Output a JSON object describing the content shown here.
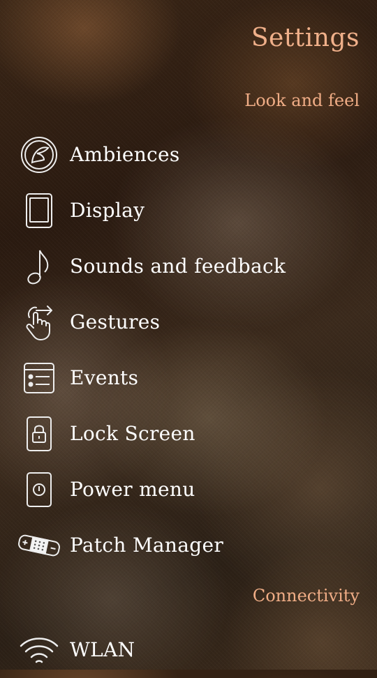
{
  "header": {
    "title": "Settings"
  },
  "sections": [
    {
      "title": "Look and feel",
      "items": [
        {
          "label": "Ambiences",
          "icon": "ambience-icon"
        },
        {
          "label": "Display",
          "icon": "display-icon"
        },
        {
          "label": "Sounds and feedback",
          "icon": "music-note-icon"
        },
        {
          "label": "Gestures",
          "icon": "gesture-hand-icon"
        },
        {
          "label": "Events",
          "icon": "events-icon"
        },
        {
          "label": "Lock Screen",
          "icon": "lock-icon"
        },
        {
          "label": "Power menu",
          "icon": "power-icon"
        },
        {
          "label": "Patch Manager",
          "icon": "bandage-icon"
        }
      ]
    },
    {
      "title": "Connectivity",
      "items": [
        {
          "label": "WLAN",
          "icon": "wifi-icon"
        }
      ]
    }
  ],
  "colors": {
    "accent": "#f0ad86",
    "text": "#ffffff"
  }
}
